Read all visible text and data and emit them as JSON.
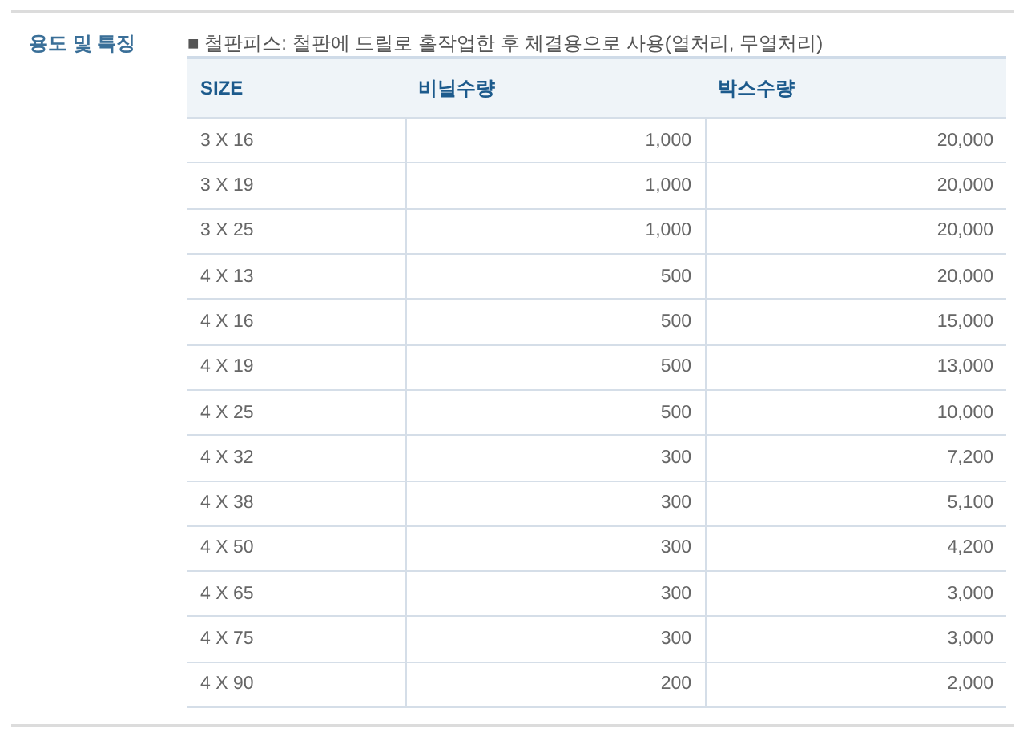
{
  "section_label": "용도 및 특징",
  "note": "■ 철판피스: 철판에 드릴로 홀작업한 후 체결용으로 사용(열처리, 무열처리)",
  "table": {
    "columns": [
      "SIZE",
      "비닐수량",
      "박스수량"
    ],
    "rows": [
      [
        "3 X 16",
        "1,000",
        "20,000"
      ],
      [
        "3 X 19",
        "1,000",
        "20,000"
      ],
      [
        "3 X 25",
        "1,000",
        "20,000"
      ],
      [
        "4 X 13",
        "500",
        "20,000"
      ],
      [
        "4 X 16",
        "500",
        "15,000"
      ],
      [
        "4 X 19",
        "500",
        "13,000"
      ],
      [
        "4 X 25",
        "500",
        "10,000"
      ],
      [
        "4 X 32",
        "300",
        "7,200"
      ],
      [
        "4 X 38",
        "300",
        "5,100"
      ],
      [
        "4 X 50",
        "300",
        "4,200"
      ],
      [
        "4 X 65",
        "300",
        "3,000"
      ],
      [
        "4 X 75",
        "300",
        "3,000"
      ],
      [
        "4 X 90",
        "200",
        "2,000"
      ]
    ]
  }
}
